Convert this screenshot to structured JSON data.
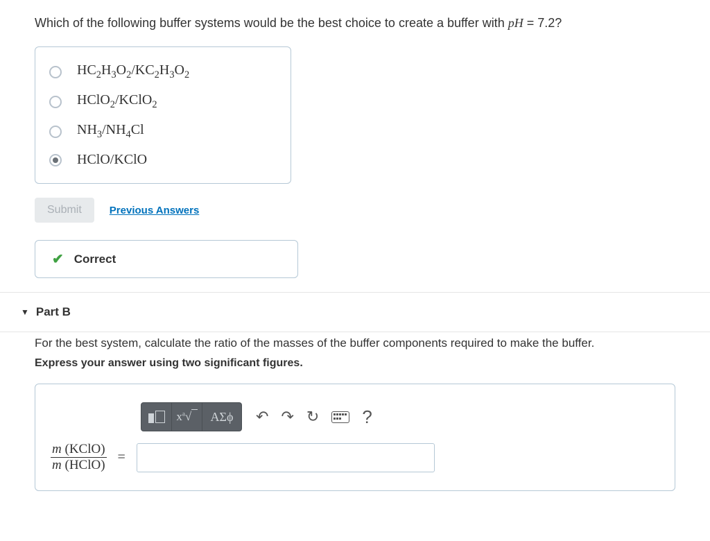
{
  "partA": {
    "question_prefix": "Which of the following buffer systems would be the best choice to create a buffer with ",
    "question_var": "pH",
    "question_suffix": " = 7.2?",
    "options": [
      {
        "html": "HC<sub>2</sub>H<sub>3</sub>O<sub>2</sub>/KC<sub>2</sub>H<sub>3</sub>O<sub>2</sub>",
        "selected": false
      },
      {
        "html": "HClO<sub>2</sub>/KClO<sub>2</sub>",
        "selected": false
      },
      {
        "html": "NH<sub>3</sub>/NH<sub>4</sub>Cl",
        "selected": false
      },
      {
        "html": "HClO/KClO",
        "selected": true
      }
    ],
    "submit_label": "Submit",
    "prev_answers_label": "Previous Answers",
    "feedback_label": "Correct"
  },
  "partB": {
    "header": "Part B",
    "prompt": "For the best system, calculate the ratio of the masses of the buffer components required to make the buffer.",
    "hint": "Express your answer using two significant figures.",
    "ratio_numerator": "m (KClO)",
    "ratio_denominator": "m (HClO)",
    "equals": "=",
    "answer_value": "",
    "toolbar": {
      "templates_tip": "templates",
      "math_tip": "math/fraction",
      "greek_label": "ΑΣϕ",
      "undo_tip": "undo",
      "redo_tip": "redo",
      "reset_tip": "reset",
      "keyboard_tip": "keyboard",
      "help_label": "?"
    }
  }
}
